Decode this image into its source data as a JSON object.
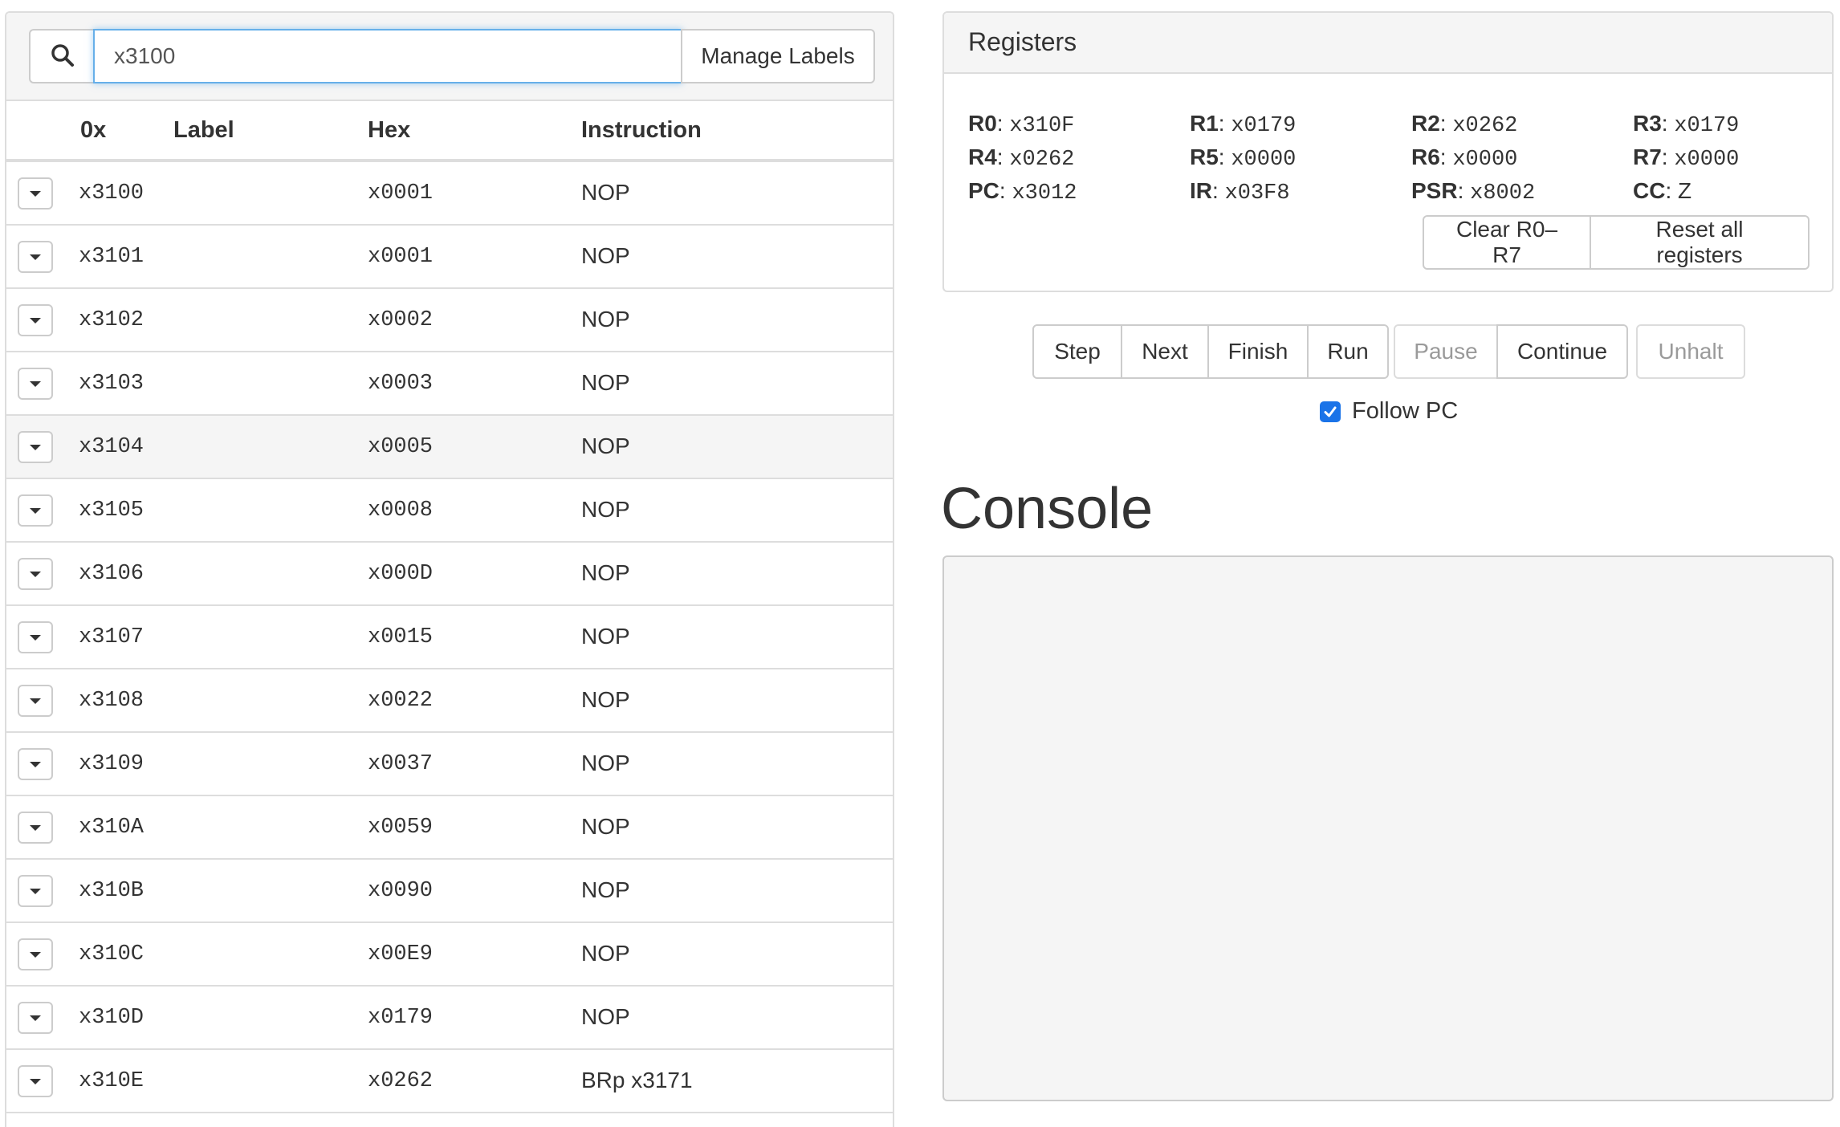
{
  "memory": {
    "search": {
      "value": "x3100",
      "icon": "search-icon"
    },
    "manage_labels_label": "Manage Labels",
    "columns": {
      "addr": "0x",
      "label": "Label",
      "hex": "Hex",
      "instruction": "Instruction"
    },
    "rows": [
      {
        "addr": "x3100",
        "label": "",
        "hex": "x0001",
        "instruction": "NOP"
      },
      {
        "addr": "x3101",
        "label": "",
        "hex": "x0001",
        "instruction": "NOP"
      },
      {
        "addr": "x3102",
        "label": "",
        "hex": "x0002",
        "instruction": "NOP"
      },
      {
        "addr": "x3103",
        "label": "",
        "hex": "x0003",
        "instruction": "NOP"
      },
      {
        "addr": "x3104",
        "label": "",
        "hex": "x0005",
        "instruction": "NOP"
      },
      {
        "addr": "x3105",
        "label": "",
        "hex": "x0008",
        "instruction": "NOP"
      },
      {
        "addr": "x3106",
        "label": "",
        "hex": "x000D",
        "instruction": "NOP"
      },
      {
        "addr": "x3107",
        "label": "",
        "hex": "x0015",
        "instruction": "NOP"
      },
      {
        "addr": "x3108",
        "label": "",
        "hex": "x0022",
        "instruction": "NOP"
      },
      {
        "addr": "x3109",
        "label": "",
        "hex": "x0037",
        "instruction": "NOP"
      },
      {
        "addr": "x310A",
        "label": "",
        "hex": "x0059",
        "instruction": "NOP"
      },
      {
        "addr": "x310B",
        "label": "",
        "hex": "x0090",
        "instruction": "NOP"
      },
      {
        "addr": "x310C",
        "label": "",
        "hex": "x00E9",
        "instruction": "NOP"
      },
      {
        "addr": "x310D",
        "label": "",
        "hex": "x0179",
        "instruction": "NOP"
      },
      {
        "addr": "x310E",
        "label": "",
        "hex": "x0262",
        "instruction": "BRp x3171"
      }
    ]
  },
  "registers": {
    "title": "Registers",
    "items": [
      {
        "name": "R0",
        "value": "x310F"
      },
      {
        "name": "R1",
        "value": "x0179"
      },
      {
        "name": "R2",
        "value": "x0262"
      },
      {
        "name": "R3",
        "value": "x0179"
      },
      {
        "name": "R4",
        "value": "x0262"
      },
      {
        "name": "R5",
        "value": "x0000"
      },
      {
        "name": "R6",
        "value": "x0000"
      },
      {
        "name": "R7",
        "value": "x0000"
      },
      {
        "name": "PC",
        "value": "x3012"
      },
      {
        "name": "IR",
        "value": "x03F8"
      },
      {
        "name": "PSR",
        "value": "x8002"
      },
      {
        "name": "CC",
        "value": "Z"
      }
    ],
    "clear_label": "Clear R0–R7",
    "reset_label": "Reset all registers"
  },
  "controls": {
    "step": "Step",
    "next": "Next",
    "finish": "Finish",
    "run": "Run",
    "pause": "Pause",
    "continue": "Continue",
    "unhalt": "Unhalt",
    "follow_pc_label": "Follow PC",
    "follow_pc_checked": true
  },
  "console": {
    "title": "Console",
    "output": ""
  },
  "colors": {
    "focus_border": "#66afe9",
    "panel_bg": "#f5f5f5",
    "checkbox": "#1a73e8"
  }
}
